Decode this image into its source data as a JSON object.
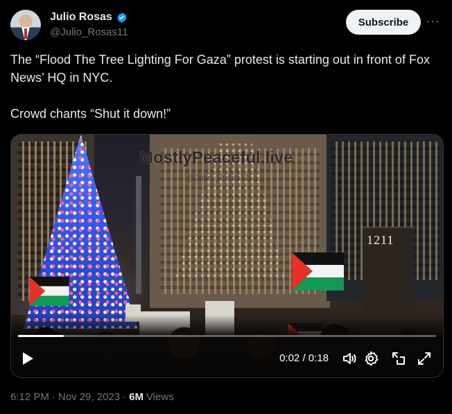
{
  "author": {
    "display_name": "Julio Rosas",
    "handle": "@Julio_Rosas11",
    "verified": true
  },
  "header": {
    "subscribe_label": "Subscribe",
    "more_label": "···"
  },
  "tweet": {
    "text": "The “Flood The Tree Lighting For Gaza” protest is starting out in front of Fox News’ HQ in NYC.\n\nCrowd chants “Shut it down!”"
  },
  "video": {
    "watermark": "MostlyPeaceful.live",
    "watermark_handle": "@Julio_Rosas11",
    "building_number": "1211",
    "current_time": "0:02",
    "duration": "0:18",
    "progress": 0.11
  },
  "footer": {
    "time": "6:12 PM",
    "separator": "·",
    "date": "Nov 29, 2023",
    "views_count": "6M",
    "views_label": "Views"
  },
  "colors": {
    "background": "#000000",
    "text": "#e7e9ea",
    "muted": "#71767b",
    "verified_blue": "#1d9bf0"
  }
}
